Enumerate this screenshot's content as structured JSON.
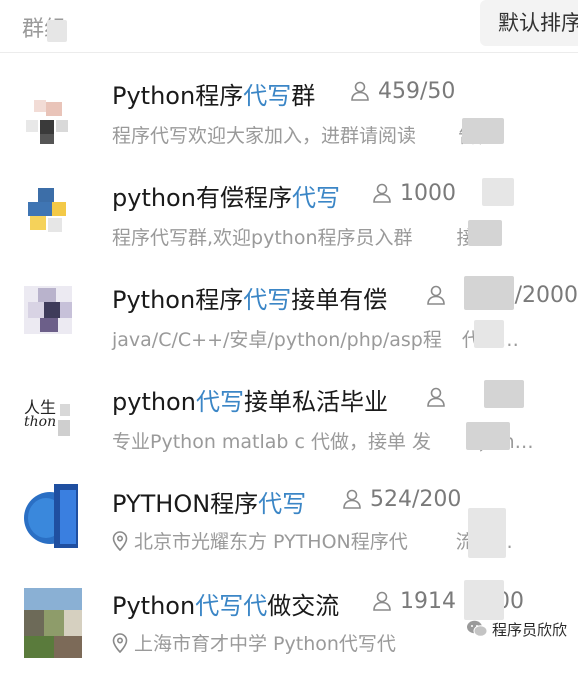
{
  "header": {
    "title": "群组",
    "sort_label": "默认排序"
  },
  "groups": [
    {
      "name_a": "Python程序",
      "name_hl": "代写",
      "name_b": "群",
      "count": "459/50",
      "desc": "程序代写欢迎大家加入，进群请阅读",
      "desc_tail": "告，"
    },
    {
      "name_a": "python有偿程序",
      "name_hl": "代写",
      "name_b": "",
      "count": "1000",
      "count_tail": "0",
      "desc": "程序代写群,欢迎python程序员入群",
      "desc_tail": "接…"
    },
    {
      "name_a": "Python程序",
      "name_hl": "代写",
      "name_b": "接单有偿",
      "count": "",
      "count_tail": ")/2000",
      "desc": "java/C/C++/安卓/python/php/asp程",
      "desc_tail": "代写…"
    },
    {
      "name_a": "python",
      "name_hl": "代写",
      "name_b": "接单私活毕业",
      "count": "",
      "count_tail": "",
      "desc": "专业Python matlab c 代做，接单 发",
      "desc_tail": "；m…"
    },
    {
      "name_a": "PYTHON程序",
      "name_hl": "代写",
      "name_b": "",
      "count": "524/200",
      "desc": "北京市光耀东方  PYTHON程序代",
      "desc_tail": "流群…"
    },
    {
      "name_a": "Python",
      "name_hl": "代写代",
      "name_b": "做交流",
      "count": "1914",
      "count_tail": "00",
      "desc": "上海市育才中学  Python代写代",
      "desc_tail": ""
    }
  ],
  "watermark": {
    "text": "程序员欣欣"
  },
  "colors": {
    "highlight": "#3b86c6",
    "secondary_text": "#9a9a9a"
  }
}
